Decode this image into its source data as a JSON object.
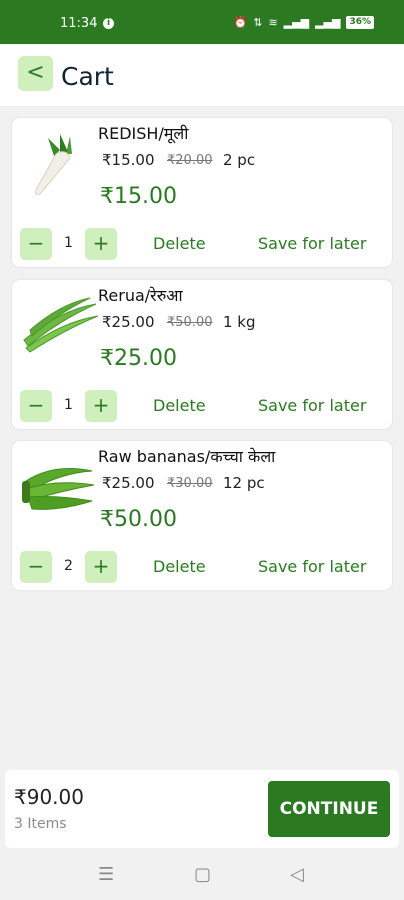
{
  "status": {
    "time": "11:34",
    "battery": "36%"
  },
  "header": {
    "back_label": "<",
    "title": "Cart"
  },
  "items": [
    {
      "name": "REDISH/मूली",
      "price": "₹15.00",
      "mrp": "₹20.00",
      "unit": "2 pc",
      "total": "₹15.00",
      "qty": "1"
    },
    {
      "name": "Rerua/रेरुआ",
      "price": "₹25.00",
      "mrp": "₹50.00",
      "unit": "1 kg",
      "total": "₹25.00",
      "qty": "1"
    },
    {
      "name": "Raw bananas/कच्चा केला",
      "price": "₹25.00",
      "mrp": "₹30.00",
      "unit": "12 pc",
      "total": "₹50.00",
      "qty": "2"
    }
  ],
  "actions": {
    "minus": "−",
    "plus": "+",
    "delete": "Delete",
    "save_for_later": "Save for later"
  },
  "footer": {
    "total": "₹90.00",
    "count": "3 Items",
    "continue": "CONTINUE"
  },
  "colors": {
    "brand": "#2b7a22",
    "button_bg": "#cfefbd",
    "page_bg": "#f1f1f1"
  },
  "icons": {
    "product_images": [
      "radish-image",
      "rerua-bean-image",
      "raw-banana-image"
    ]
  }
}
